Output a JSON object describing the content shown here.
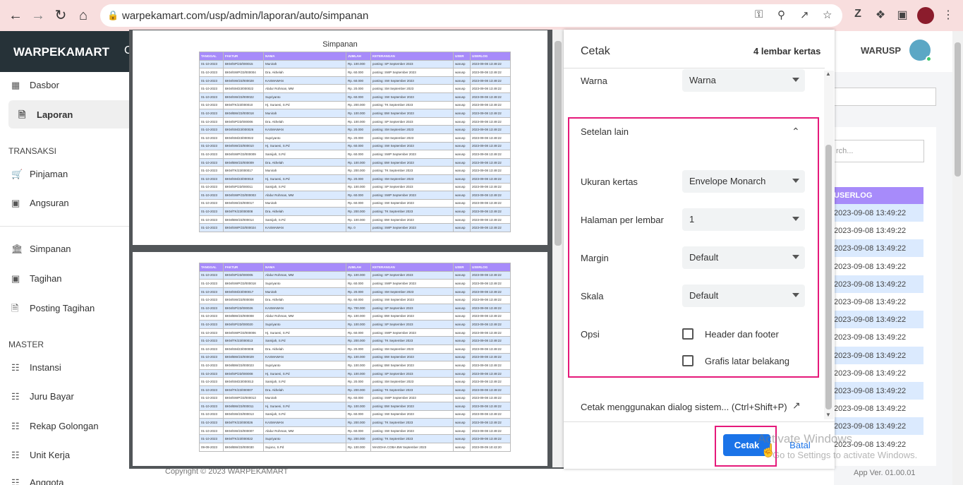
{
  "browser": {
    "url": "warpekamart.com/usp/admin/laporan/auto/simpanan"
  },
  "app": {
    "brand": "WARPEKAMART",
    "brand_cut": "C",
    "user": "WARUSP",
    "footer": "Copyright © 2023 WARPEKAMART",
    "version": "App Ver. 01.00.01"
  },
  "sidebar": {
    "items": [
      {
        "label": "Dasbor",
        "icon": "dashboard-icon"
      },
      {
        "label": "Laporan",
        "icon": "file-icon"
      },
      {
        "label": "Pinjaman",
        "icon": "cart-icon"
      },
      {
        "label": "Angsuran",
        "icon": "camera-icon"
      },
      {
        "label": "Simpanan",
        "icon": "bank-icon"
      },
      {
        "label": "Tagihan",
        "icon": "camera-icon"
      },
      {
        "label": "Posting Tagihan",
        "icon": "file-icon"
      },
      {
        "label": "Instansi",
        "icon": "book-icon"
      },
      {
        "label": "Juru Bayar",
        "icon": "book-icon"
      },
      {
        "label": "Rekap Golongan",
        "icon": "book-icon"
      },
      {
        "label": "Unit Kerja",
        "icon": "book-icon"
      },
      {
        "label": "Anggota",
        "icon": "book-icon"
      }
    ],
    "sections": {
      "transaksi": "TRANSAKSI",
      "master": "MASTER"
    }
  },
  "background": {
    "search_placeholder": "rch...",
    "col_header": "USERLOG",
    "rows": [
      "2023-09-08 13:49:22",
      "2023-09-08 13:49:22",
      "2023-09-08 13:49:22",
      "2023-09-08 13:49:22",
      "2023-09-08 13:49:22",
      "2023-09-08 13:49:22",
      "2023-09-08 13:49:22",
      "2023-09-08 13:49:22",
      "2023-09-08 13:49:22",
      "2023-09-08 13:49:22",
      "2023-09-08 13:49:22",
      "2023-09-08 13:49:22",
      "2023-09-08 13:49:22",
      "2023-09-08 13:49:22"
    ]
  },
  "preview": {
    "title": "Simpanan",
    "headers": [
      "TANGGAL",
      "FAKTUR",
      "NAMA",
      "JUMLAH",
      "KETERANGAN",
      "USER",
      "USERLOG"
    ],
    "page1": [
      [
        "01-10-2023",
        "BKM/SP/23/000015",
        "Munirah",
        "Rp. 100.000",
        "posting: SP September 2023",
        "warusp",
        "2023-09-08 13:49:22"
      ],
      [
        "01-10-2023",
        "BKM/SWP/23/000004",
        "Dra. Akhelah",
        "Rp. 60.000",
        "posting: SWP September 2023",
        "warusp",
        "2023-09-08 13:49:22"
      ],
      [
        "01-10-2023",
        "BKM/SW/23/000028",
        "KASMAWAN",
        "Rp. 60.000",
        "posting: SW September 2023",
        "warusp",
        "2023-09-08 13:49:22"
      ],
      [
        "01-10-2023",
        "BKM/SM/23/000022",
        "Abdur Rohman, MM",
        "Rp. 20.000",
        "posting: SM September 2023",
        "warusp",
        "2023-09-08 13:49:22"
      ],
      [
        "01-10-2023",
        "BKM/SW/23/000022",
        "Supriyanto",
        "Rp. 60.000",
        "posting: SW September 2023",
        "warusp",
        "2023-09-08 13:49:22"
      ],
      [
        "01-10-2023",
        "BKM/TK/23/000010",
        "Hj. Suraeni, S.Pd",
        "Rp. 200.000",
        "posting: TK September 2023",
        "warusp",
        "2023-09-08 13:49:22"
      ],
      [
        "01-10-2023",
        "BKM/BW/23/000018",
        "Munirah",
        "Rp. 100.000",
        "posting: BW September 2023",
        "warusp",
        "2023-09-08 13:49:22"
      ],
      [
        "01-10-2023",
        "BKM/SP/23/000006",
        "Dra. Akhelah",
        "Rp. 100.000",
        "posting: SP September 2023",
        "warusp",
        "2023-09-08 13:49:22"
      ],
      [
        "01-10-2023",
        "BKM/SM/23/000026",
        "KASMAWAN",
        "Rp. 20.000",
        "posting: SM September 2023",
        "warusp",
        "2023-09-08 13:49:22"
      ],
      [
        "01-10-2023",
        "BKM/SM/23/000022",
        "Supriyanto",
        "Rp. 20.000",
        "posting: SM September 2023",
        "warusp",
        "2023-09-08 13:49:22"
      ],
      [
        "01-10-2023",
        "BKM/SW/23/000010",
        "Hj. Suraeni, S.Pd",
        "Rp. 60.000",
        "posting: SW September 2023",
        "warusp",
        "2023-09-08 13:49:22"
      ],
      [
        "01-10-2023",
        "BKM/SWP/23/000009",
        "Samijah, S.Pd",
        "Rp. 60.000",
        "posting: SWP September 2023",
        "warusp",
        "2023-09-08 13:49:22"
      ],
      [
        "01-10-2023",
        "BKM/BW/23/000009",
        "Dra. Akhelah",
        "Rp. 100.000",
        "posting: BW September 2023",
        "warusp",
        "2023-09-08 13:49:22"
      ],
      [
        "01-10-2023",
        "BKM/TK/23/000017",
        "Munirah",
        "Rp. 200.000",
        "posting: TK September 2023",
        "warusp",
        "2023-09-08 13:49:22"
      ],
      [
        "01-10-2023",
        "BKM/SM/23/000010",
        "Hj. Suraeni, S.Pd",
        "Rp. 20.000",
        "posting: SM September 2023",
        "warusp",
        "2023-09-08 13:49:22"
      ],
      [
        "01-10-2023",
        "BKM/SP/23/000011",
        "Samijah, S.Pd",
        "Rp. 100.000",
        "posting: SP September 2023",
        "warusp",
        "2023-09-08 13:49:22"
      ],
      [
        "01-10-2023",
        "BKM/SWP/23/000003",
        "Abdur Rohman, MM",
        "Rp. 60.000",
        "posting: SWP September 2023",
        "warusp",
        "2023-09-08 13:49:22"
      ],
      [
        "01-10-2023",
        "BKM/SW/23/000017",
        "Munirah",
        "Rp. 60.000",
        "posting: SW September 2023",
        "warusp",
        "2023-09-08 13:49:22"
      ],
      [
        "01-10-2023",
        "BKM/TK/23/000008",
        "Dra. Akhelah",
        "Rp. 200.000",
        "posting: TK September 2023",
        "warusp",
        "2023-09-08 13:49:22"
      ],
      [
        "01-10-2023",
        "BKM/BW/23/000014",
        "Samijah, S.Pd",
        "Rp. 100.000",
        "posting: BW September 2023",
        "warusp",
        "2023-09-08 13:49:22"
      ],
      [
        "01-10-2023",
        "BKM/SWP/23/000024",
        "KASMAWAN",
        "Rp. 0",
        "posting: SWP September 2023",
        "warusp",
        "2023-09-08 13:49:22"
      ]
    ],
    "page2": [
      [
        "01-10-2023",
        "BKM/SP/23/000005",
        "Abdur Rohman, MM",
        "Rp. 100.000",
        "posting: SP September 2023",
        "warusp",
        "2023-09-08 13:49:22"
      ],
      [
        "01-10-2023",
        "BKM/SWP/23/000018",
        "Supriyanto",
        "Rp. 60.000",
        "posting: SWP September 2023",
        "warusp",
        "2023-09-08 13:49:22"
      ],
      [
        "01-10-2023",
        "BKM/SM/23/000017",
        "Munirah",
        "Rp. 20.000",
        "posting: SM September 2023",
        "warusp",
        "2023-09-08 13:49:22"
      ],
      [
        "01-10-2023",
        "BKM/SW/23/000008",
        "Dra. Akhelah",
        "Rp. 60.000",
        "posting: SW September 2023",
        "warusp",
        "2023-09-08 13:49:22"
      ],
      [
        "01-10-2023",
        "BKM/SP/23/000026",
        "KASMAWAN",
        "Rp. 700.000",
        "posting: SP September 2023",
        "warusp",
        "2023-09-08 13:49:22"
      ],
      [
        "01-10-2023",
        "BKM/BW/23/000008",
        "Abdur Rohman, MM",
        "Rp. 100.000",
        "posting: BW September 2023",
        "warusp",
        "2023-09-08 13:49:22"
      ],
      [
        "01-10-2023",
        "BKM/SP/23/000020",
        "Supriyanto",
        "Rp. 100.000",
        "posting: SP September 2023",
        "warusp",
        "2023-09-08 13:49:22"
      ],
      [
        "01-10-2023",
        "BKM/SWP/23/000006",
        "Hj. Suraeni, S.Pd",
        "Rp. 60.000",
        "posting: SWP September 2023",
        "warusp",
        "2023-09-08 13:49:22"
      ],
      [
        "01-10-2023",
        "BKM/TK/23/000013",
        "Samijah, S.Pd",
        "Rp. 200.000",
        "posting: TK September 2023",
        "warusp",
        "2023-09-08 13:49:22"
      ],
      [
        "01-10-2023",
        "BKM/SM/23/000008",
        "Dra. Akhelah",
        "Rp. 20.000",
        "posting: SM September 2023",
        "warusp",
        "2023-09-08 13:49:22"
      ],
      [
        "01-10-2023",
        "BKM/BW/23/000029",
        "KASMAWAN",
        "Rp. 100.000",
        "posting: BW September 2023",
        "warusp",
        "2023-09-08 13:49:22"
      ],
      [
        "01-10-2023",
        "BKM/BW/23/000023",
        "Supriyanto",
        "Rp. 100.000",
        "posting: BW September 2023",
        "warusp",
        "2023-09-08 13:49:22"
      ],
      [
        "01-10-2023",
        "BKM/SP/23/000008",
        "Hj. Suraeni, S.Pd",
        "Rp. 100.000",
        "posting: SP September 2023",
        "warusp",
        "2023-09-08 13:49:22"
      ],
      [
        "01-10-2023",
        "BKM/SM/23/000013",
        "Samijah, S.Pd",
        "Rp. 20.000",
        "posting: SM September 2023",
        "warusp",
        "2023-09-08 13:49:22"
      ],
      [
        "01-10-2023",
        "BKM/TK/23/000007",
        "Dra. Akhelah",
        "Rp. 200.000",
        "posting: TK September 2023",
        "warusp",
        "2023-09-08 13:49:22"
      ],
      [
        "01-10-2023",
        "BKM/SWP/23/000013",
        "Munirah",
        "Rp. 60.000",
        "posting: SWP September 2023",
        "warusp",
        "2023-09-08 13:49:22"
      ],
      [
        "01-10-2023",
        "BKM/BW/23/000011",
        "Hj. Suraeni, S.Pd",
        "Rp. 100.000",
        "posting: BW September 2023",
        "warusp",
        "2023-09-08 13:49:22"
      ],
      [
        "01-10-2023",
        "BKM/SW/23/000013",
        "Samijah, S.Pd",
        "Rp. 60.000",
        "posting: SW September 2023",
        "warusp",
        "2023-09-08 13:49:22"
      ],
      [
        "01-10-2023",
        "BKM/TK/23/000026",
        "KASMAWAN",
        "Rp. 200.000",
        "posting: TK September 2023",
        "warusp",
        "2023-09-08 13:49:22"
      ],
      [
        "01-10-2023",
        "BKM/SW/23/000007",
        "Abdur Rohman, MM",
        "Rp. 60.000",
        "posting: SW September 2023",
        "warusp",
        "2023-09-08 13:49:22"
      ],
      [
        "01-10-2023",
        "BKM/TK/23/000022",
        "Supriyanto",
        "Rp. 200.000",
        "posting: TK September 2023",
        "warusp",
        "2023-09-08 13:49:22"
      ],
      [
        "09-09-2023",
        "BKM/BW/23/000030",
        "Sujono, S.Pd",
        "Rp. 100.000",
        "MAGDHA COBA BW September 2023",
        "warusp",
        "2023-09-09 10:43:20"
      ]
    ]
  },
  "dialog": {
    "title": "Cetak",
    "sheet_count": "4 lembar kertas",
    "warna_label": "Warna",
    "warna_value": "Warna",
    "more_settings": "Setelan lain",
    "paper_label": "Ukuran kertas",
    "paper_value": "Envelope Monarch",
    "pages_label": "Halaman per lembar",
    "pages_value": "1",
    "margin_label": "Margin",
    "margin_value": "Default",
    "scale_label": "Skala",
    "scale_value": "Default",
    "options_label": "Opsi",
    "opt_header": "Header dan footer",
    "opt_bg": "Grafis latar belakang",
    "system_dialog": "Cetak menggunakan dialog sistem... (Ctrl+Shift+P)",
    "print_btn": "Cetak",
    "cancel_btn": "Batal"
  },
  "watermark": {
    "line1": "Activate Windows",
    "line2": "Go to Settings to activate Windows."
  },
  "colors": {
    "highlight": "#e5197a",
    "primary": "#1a73e8",
    "table_header": "#a78bfa",
    "row_alt": "#dbeafe"
  }
}
